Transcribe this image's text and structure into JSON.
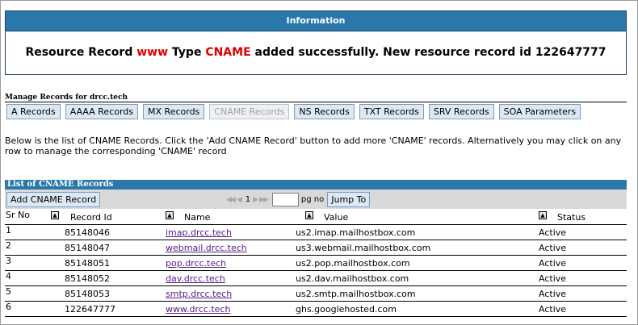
{
  "info": {
    "header": "Information",
    "msg_prefix": "Resource Record ",
    "record_name": "www",
    "msg_middle": " Type ",
    "record_type": "CNAME",
    "msg_suffix": " added successfully. New resource record id 122647777"
  },
  "manage": {
    "title": "Manage Records for drcc.tech",
    "tabs": [
      {
        "label": "A Records"
      },
      {
        "label": "AAAA Records"
      },
      {
        "label": "MX Records"
      },
      {
        "label": "CNAME Records"
      },
      {
        "label": "NS Records"
      },
      {
        "label": "TXT Records"
      },
      {
        "label": "SRV Records"
      },
      {
        "label": "SOA Parameters"
      }
    ],
    "description": "Below is the list of CNAME Records. Click the 'Add CNAME Record' button to add more 'CNAME' records. Alternatively you may click on any row to manage the corresponding 'CNAME' record"
  },
  "list": {
    "title": "List of CNAME Records",
    "add_button": "Add CNAME Record",
    "pager": {
      "page": "1",
      "input_value": "",
      "pg_label": "pg no",
      "jump_label": "Jump To"
    },
    "columns": {
      "sr": "Sr No",
      "id": "Record Id",
      "name": "Name",
      "value": "Value",
      "status": "Status"
    },
    "rows": [
      {
        "sr": "1",
        "id": "85148046",
        "name": "imap.drcc.tech",
        "value": "us2.imap.mailhostbox.com",
        "status": "Active"
      },
      {
        "sr": "2",
        "id": "85148047",
        "name": "webmail.drcc.tech",
        "value": "us3.webmail.mailhostbox.com",
        "status": "Active"
      },
      {
        "sr": "3",
        "id": "85148051",
        "name": "pop.drcc.tech",
        "value": "us2.pop.mailhostbox.com",
        "status": "Active"
      },
      {
        "sr": "4",
        "id": "85148052",
        "name": "dav.drcc.tech",
        "value": "us2.dav.mailhostbox.com",
        "status": "Active"
      },
      {
        "sr": "5",
        "id": "85148053",
        "name": "smtp.drcc.tech",
        "value": "us2.smtp.mailhostbox.com",
        "status": "Active"
      },
      {
        "sr": "6",
        "id": "122647777",
        "name": "www.drcc.tech",
        "value": "ghs.googlehosted.com",
        "status": "Active"
      }
    ]
  }
}
